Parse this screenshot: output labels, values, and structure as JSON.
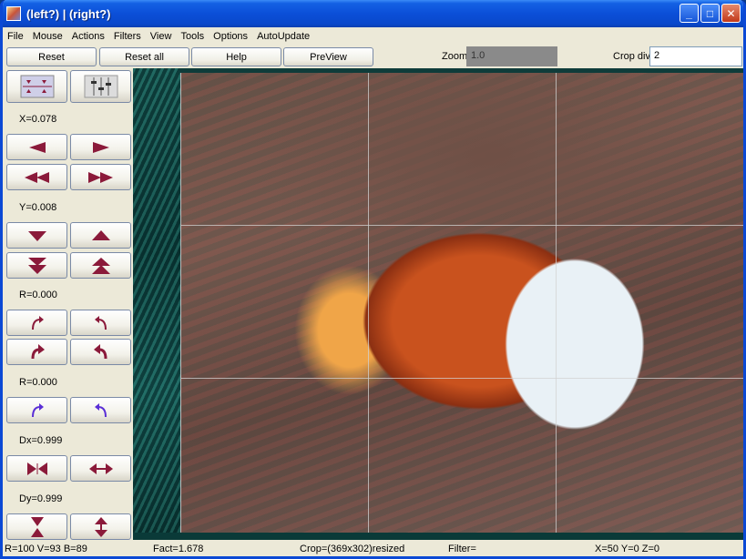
{
  "window": {
    "title": "(left?) | (right?)",
    "controls": {
      "minimize": "_",
      "maximize": "□",
      "close": "✕"
    }
  },
  "menu": [
    "File",
    "Mouse",
    "Actions",
    "Filters",
    "View",
    "Tools",
    "Options",
    "AutoUpdate"
  ],
  "toolbar": {
    "reset_label": "Reset",
    "reset_all_label": "Reset all",
    "help_label": "Help",
    "preview_label": "PreView",
    "zoom_label": "Zoom",
    "zoom_value": "1.0",
    "crop_div_label": "Crop div",
    "crop_div_value": "2"
  },
  "panel": {
    "x_label": "X=0.078",
    "y_label": "Y=0.008",
    "r1_label": "R=0.000",
    "r2_label": "R=0.000",
    "dx_label": "Dx=0.999",
    "dy_label": "Dy=0.999"
  },
  "icons": {
    "arrow_color": "#8b1a3a",
    "rotate_color": "#5a2fd6"
  },
  "status": {
    "rvb": "R=100 V=93 B=89",
    "fact": "Fact=1.678",
    "crop": "Crop=(369x302)resized",
    "filter": "Filter=",
    "xyz": "X=50 Y=0 Z=0"
  }
}
